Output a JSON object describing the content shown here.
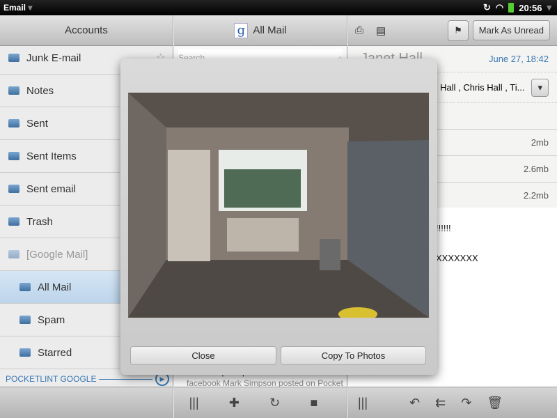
{
  "status": {
    "app": "Email",
    "time": "20:56"
  },
  "accounts": {
    "title": "Accounts",
    "items": [
      {
        "label": "Junk E-mail",
        "starred": true
      },
      {
        "label": "Notes"
      },
      {
        "label": "Sent"
      },
      {
        "label": "Sent Items"
      },
      {
        "label": "Sent email"
      },
      {
        "label": "Trash"
      },
      {
        "label": "[Google Mail]",
        "dim": true
      },
      {
        "label": "All Mail",
        "selected": true,
        "sub": true
      },
      {
        "label": "Spam",
        "sub": true
      },
      {
        "label": "Starred",
        "sub": true
      }
    ],
    "account_name": "POCKETLINT GOOGLE"
  },
  "list": {
    "title": "All Mail",
    "search_placeholder": "Search",
    "preview_from": "Mark Simpson posted on Pocket-lint's Wall.",
    "preview_snippet": "facebook Mark Simpson posted on Pocket-lin..."
  },
  "message": {
    "mark_unread": "Mark As Unread",
    "sender": "Janet Hall",
    "date": "June 27, 18:42",
    "recipients": "s Hall ,  Chris Hall ,  Ti...",
    "attachments": [
      "2mb",
      "2.6mb",
      "2.2mb"
    ],
    "body_lines": [
      "!!!!!!",
      "XXXXXXX"
    ]
  },
  "dialog": {
    "close": "Close",
    "copy": "Copy To Photos"
  },
  "colors": {
    "accent": "#3a78b5",
    "selected": "#c8dcef"
  }
}
